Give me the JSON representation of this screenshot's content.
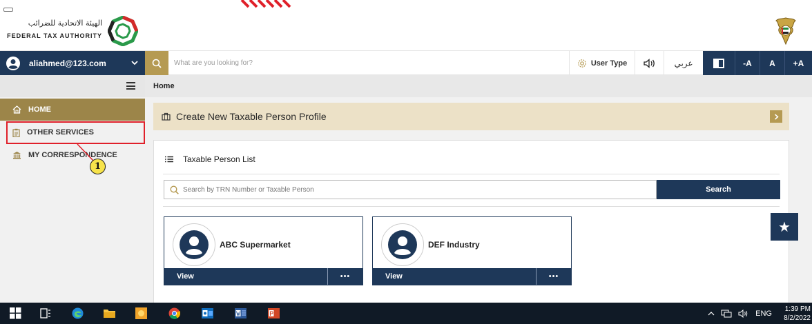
{
  "header": {
    "logo_arabic": "الهيئة الاتحادية للضرائب",
    "logo_english": "FEDERAL TAX AUTHORITY",
    "colors": {
      "navy": "#1e3859",
      "gold": "#b59a52",
      "home_active": "#9c8549",
      "create_card": "#ece1c7"
    }
  },
  "topbar": {
    "user_email": "aliahmed@123.com",
    "search_placeholder": "What are you looking for?",
    "user_type_label": "User Type",
    "language_label": "عربي",
    "font_decrease": "-A",
    "font_normal": "A",
    "font_increase": "+A"
  },
  "sidebar": {
    "items": [
      {
        "label": "HOME",
        "icon": "home-icon",
        "active": true
      },
      {
        "label": "OTHER SERVICES",
        "icon": "clipboard-icon",
        "active": false
      },
      {
        "label": "MY CORRESPONDENCE",
        "icon": "building-icon",
        "active": false
      }
    ],
    "callout_number": "1"
  },
  "main": {
    "breadcrumb": "Home",
    "create_profile_label": "Create New Taxable Person Profile",
    "list": {
      "title": "Taxable Person List",
      "search_placeholder": "Search by TRN Number or Taxable Person",
      "search_button": "Search",
      "cards": [
        {
          "name": "ABC Supermarket",
          "view_label": "View",
          "more_label": "•••"
        },
        {
          "name": "DEF Industry",
          "view_label": "View",
          "more_label": "•••"
        }
      ]
    },
    "favorite_icon": "★"
  },
  "taskbar": {
    "tray_language": "ENG",
    "time": "1:39 PM",
    "date": "8/2/2022"
  }
}
